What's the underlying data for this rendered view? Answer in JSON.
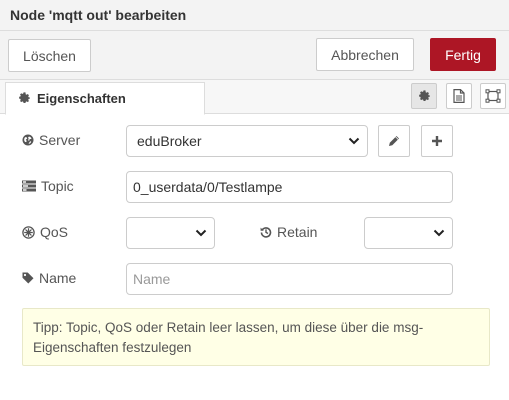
{
  "dialog": {
    "title": "Node 'mqtt out' bearbeiten"
  },
  "toolbar": {
    "delete_label": "Löschen",
    "cancel_label": "Abbrechen",
    "done_label": "Fertig",
    "done_color": "#ad1625"
  },
  "tabs": {
    "properties_label": "Eigenschaften",
    "buttons": [
      "gear-icon",
      "description-icon",
      "appearance-icon"
    ]
  },
  "form": {
    "server": {
      "label": "Server",
      "value": "eduBroker",
      "icon": "globe-icon"
    },
    "topic": {
      "label": "Topic",
      "value": "0_userdata/0/Testlampe",
      "icon": "tasks-icon"
    },
    "qos": {
      "label": "QoS",
      "value": "",
      "icon": "empire-icon"
    },
    "retain": {
      "label": "Retain",
      "value": "",
      "icon": "history-icon"
    },
    "name": {
      "label": "Name",
      "value": "",
      "placeholder": "Name",
      "icon": "tag-icon"
    }
  },
  "tip": {
    "text": "Tipp: Topic, QoS oder Retain leer lassen, um diese über die msg-Eigenschaften festzulegen"
  }
}
